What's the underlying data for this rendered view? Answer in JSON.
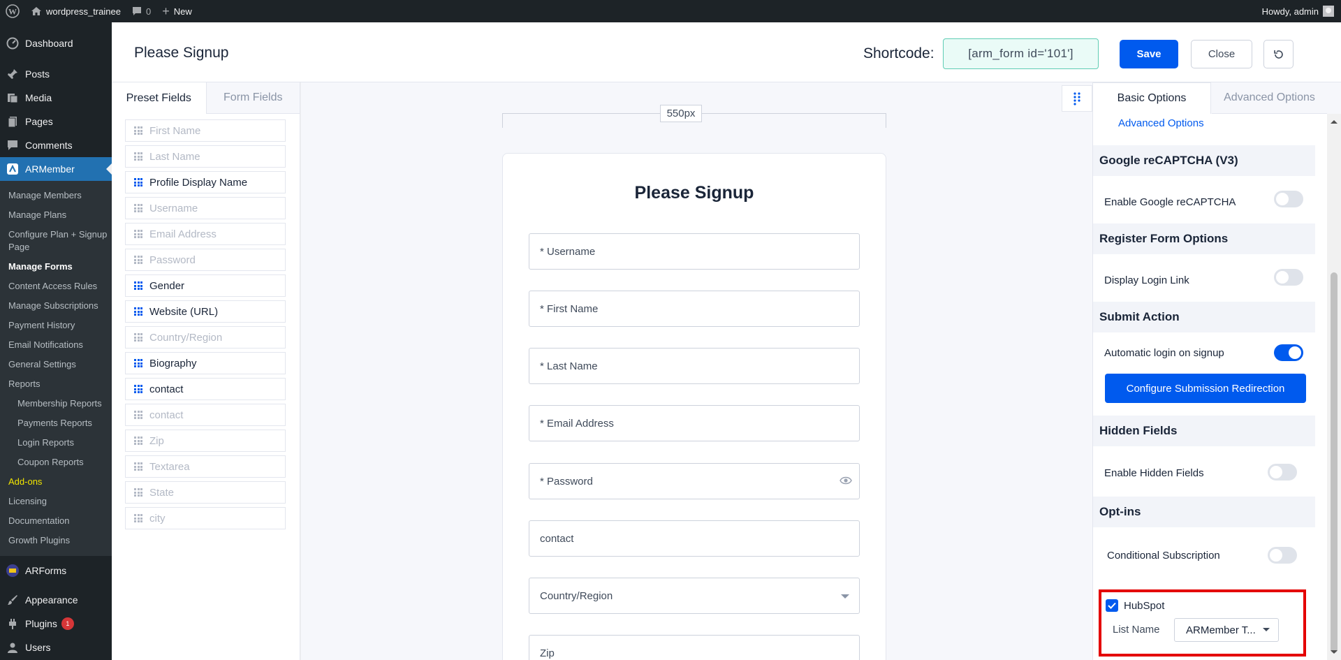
{
  "admin_bar": {
    "site_name": "wordpress_trainee",
    "comments_count": "0",
    "new_label": "New",
    "greeting": "Howdy, admin"
  },
  "sidebar": {
    "dashboard": "Dashboard",
    "posts": "Posts",
    "media": "Media",
    "pages": "Pages",
    "comments": "Comments",
    "armember": "ARMember",
    "submenu": [
      "Manage Members",
      "Manage Plans",
      "Configure Plan + Signup Page",
      "Manage Forms",
      "Content Access Rules",
      "Manage Subscriptions",
      "Payment History",
      "Email Notifications",
      "General Settings",
      "Reports",
      "Membership Reports",
      "Payments Reports",
      "Login Reports",
      "Coupon Reports",
      "Add-ons",
      "Licensing",
      "Documentation",
      "Growth Plugins"
    ],
    "arforms": "ARForms",
    "appearance": "Appearance",
    "plugins": "Plugins",
    "plugins_badge": "1",
    "users": "Users"
  },
  "header": {
    "title": "Please Signup",
    "shortcode_label": "Shortcode:",
    "shortcode_value": "[arm_form id='101']",
    "save_label": "Save",
    "close_label": "Close"
  },
  "fields_panel": {
    "tabs": [
      "Preset Fields",
      "Form Fields"
    ],
    "items": [
      {
        "label": "First Name",
        "enabled": false
      },
      {
        "label": "Last Name",
        "enabled": false
      },
      {
        "label": "Profile Display Name",
        "enabled": true
      },
      {
        "label": "Username",
        "enabled": false
      },
      {
        "label": "Email Address",
        "enabled": false
      },
      {
        "label": "Password",
        "enabled": false
      },
      {
        "label": "Gender",
        "enabled": true
      },
      {
        "label": "Website (URL)",
        "enabled": true
      },
      {
        "label": "Country/Region",
        "enabled": false
      },
      {
        "label": "Biography",
        "enabled": true
      },
      {
        "label": "contact",
        "enabled": true
      },
      {
        "label": "contact",
        "enabled": false
      },
      {
        "label": "Zip",
        "enabled": false
      },
      {
        "label": "Textarea",
        "enabled": false
      },
      {
        "label": "State",
        "enabled": false
      },
      {
        "label": "city",
        "enabled": false
      }
    ]
  },
  "canvas": {
    "width_label": "550px",
    "form_title": "Please Signup",
    "inputs": [
      "* Username",
      "* First Name",
      "* Last Name",
      "* Email Address",
      "* Password",
      "contact",
      "Country/Region",
      "Zip"
    ]
  },
  "options": {
    "tabs": [
      "Basic Options",
      "Advanced Options"
    ],
    "advanced_link": "Advanced Options",
    "recaptcha_head": "Google reCAPTCHA (V3)",
    "recaptcha_label": "Enable Google reCAPTCHA",
    "recaptcha_on": false,
    "register_head": "Register Form Options",
    "login_link_label": "Display Login Link",
    "login_link_on": false,
    "submit_head": "Submit Action",
    "auto_login_label": "Automatic login on signup",
    "auto_login_on": true,
    "redirect_button": "Configure Submission Redirection",
    "hidden_head": "Hidden Fields",
    "hidden_label": "Enable Hidden Fields",
    "hidden_on": false,
    "optins_head": "Opt-ins",
    "conditional_label": "Conditional Subscription",
    "conditional_on": false,
    "hubspot_label": "HubSpot",
    "hubspot_checked": true,
    "list_name_label": "List Name",
    "list_name_value": "ARMember T..."
  },
  "colors": {
    "accent": "#005aee",
    "wp_admin": "#1d2327",
    "highlight_border": "#e40000"
  }
}
